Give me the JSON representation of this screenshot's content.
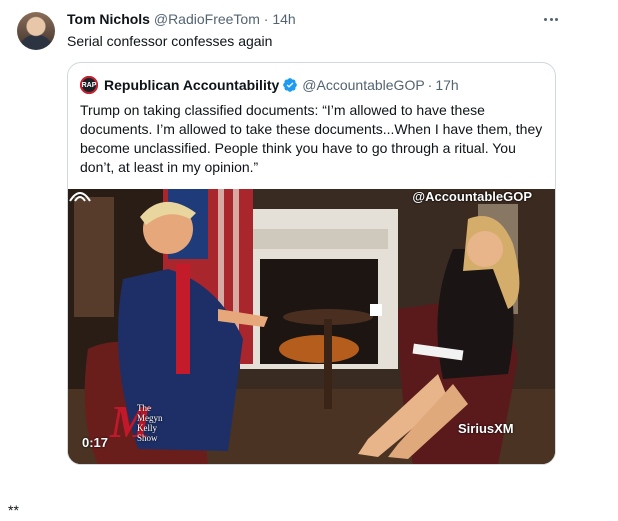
{
  "tweet": {
    "author_name": "Tom Nichols",
    "handle": "@RadioFreeTom",
    "separator": "·",
    "time": "14h",
    "text": "Serial confessor confesses again",
    "more_icon": "more-horizontal-icon"
  },
  "quoted": {
    "avatar_initials": "RAP",
    "author_name": "Republican Accountability",
    "verified_icon": "verified-badge-icon",
    "verified_color": "#1d9bf0",
    "handle": "@AccountableGOP",
    "separator": "·",
    "time": "17h",
    "text": "Trump on taking classified documents: “I’m allowed to have these documents. I’m allowed to take these documents...When I have them, they become unclassified. People think you have to go through a ritual. You don’t, at least in my opinion.”",
    "media": {
      "watermark": "@AccountableGOP",
      "duration": "0:17",
      "show_logo_letter": "M",
      "show_logo_lines": [
        "The",
        "Megyn",
        "Kelly",
        "Show"
      ],
      "sirius_logo": "SiriusXM"
    }
  },
  "footnote": "**"
}
